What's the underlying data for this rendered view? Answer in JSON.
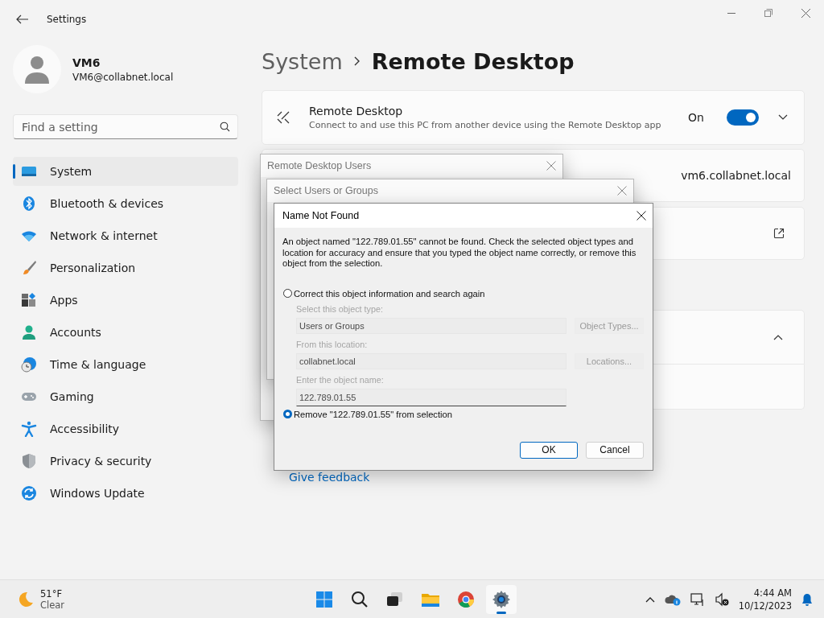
{
  "window": {
    "title": "Settings"
  },
  "user": {
    "name": "VM6",
    "email": "VM6@collabnet.local"
  },
  "search": {
    "placeholder": "Find a setting"
  },
  "nav": [
    {
      "label": "System",
      "selected": true
    },
    {
      "label": "Bluetooth & devices",
      "selected": false
    },
    {
      "label": "Network & internet",
      "selected": false
    },
    {
      "label": "Personalization",
      "selected": false
    },
    {
      "label": "Apps",
      "selected": false
    },
    {
      "label": "Accounts",
      "selected": false
    },
    {
      "label": "Time & language",
      "selected": false
    },
    {
      "label": "Gaming",
      "selected": false
    },
    {
      "label": "Accessibility",
      "selected": false
    },
    {
      "label": "Privacy & security",
      "selected": false
    },
    {
      "label": "Windows Update",
      "selected": false
    }
  ],
  "breadcrumb": [
    "System",
    "Remote Desktop"
  ],
  "remote_desktop": {
    "title": "Remote Desktop",
    "description": "Connect to and use this PC from another device using the Remote Desktop app",
    "state_label": "On",
    "on": true,
    "expanded": false
  },
  "pc_name": {
    "value": "vm6.collabnet.local"
  },
  "users_section": {
    "expanded": true
  },
  "feedback_link": "Give feedback",
  "background_dialogs": [
    {
      "title": "Remote Desktop Users"
    },
    {
      "title": "Select Users or Groups"
    }
  ],
  "name_not_found": {
    "title": "Name Not Found",
    "message": "An object named \"122.789.01.55\" cannot be found. Check the selected object types and location for accuracy and ensure that you typed the object name correctly, or remove this object from the selection.",
    "options": [
      {
        "label": "Correct this object information and search again",
        "selected": false
      },
      {
        "label": "Remove \"122.789.01.55\" from selection",
        "selected": true
      }
    ],
    "fields": [
      {
        "label": "Select this object type:",
        "value": "Users or Groups",
        "button": "Object Types...",
        "disabled": true
      },
      {
        "label": "From this location:",
        "value": "collabnet.local",
        "button": "Locations...",
        "disabled": true
      },
      {
        "label": "Enter the object name:",
        "value": "122.789.01.55",
        "disabled": true
      }
    ],
    "buttons": [
      "OK",
      "Cancel"
    ]
  },
  "taskbar": {
    "temperature": "51°F",
    "condition": "Clear",
    "time": "4:44 AM",
    "date": "10/12/2023"
  }
}
